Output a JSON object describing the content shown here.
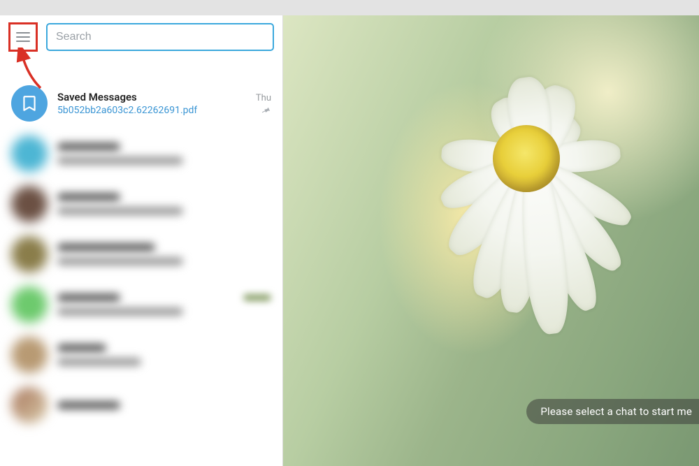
{
  "search": {
    "placeholder": "Search",
    "value": ""
  },
  "annotation": {
    "highlight": "hamburger-menu",
    "box_color": "#d93025",
    "arrow_color": "#d93025"
  },
  "chats": {
    "saved": {
      "name": "Saved Messages",
      "date": "Thu",
      "preview": "5b052bb2a603c2.62262691.pdf",
      "pinned": true,
      "avatar_icon": "bookmark"
    }
  },
  "empty_state": {
    "hint": "Please select a chat to start me"
  },
  "colors": {
    "accent": "#3ba8dd",
    "highlight_box": "#d93025",
    "link": "#3a95d4"
  }
}
